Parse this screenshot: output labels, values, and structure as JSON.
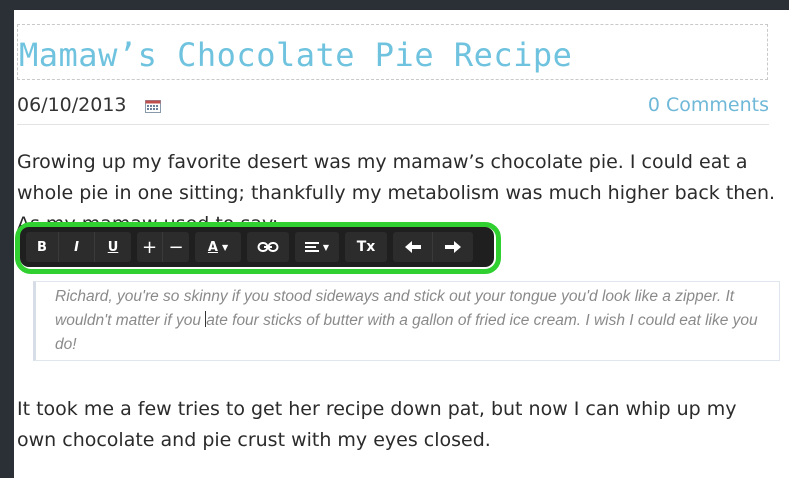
{
  "post": {
    "title": "Mamaw’s Chocolate Pie Recipe",
    "date": "06/10/2013",
    "comments_link": "0 Comments",
    "paragraph1": "Growing up my favorite desert was my mamaw’s chocolate pie. I could eat a whole pie in one sitting; thankfully my metabolism was much higher back then. As my mamaw used to say:",
    "quote_before_cursor": "Richard, you're so skinny if you stood sideways and stick out your tongue you'd look like a zipper. It wouldn't matter if you ",
    "quote_after_cursor": "ate four sticks of butter with a gallon of fried ice cream. I wish I could eat like you do!",
    "paragraph2": "It took me a few tries to get her recipe down pat, but now I can whip up my own chocolate and pie crust with my eyes closed."
  },
  "toolbar": {
    "bold": "B",
    "italic": "I",
    "underline": "U",
    "increase": "+",
    "decrease": "−",
    "font_color": "A",
    "clear_format": "Tx",
    "icons": [
      "calendar-icon",
      "link-icon",
      "align-icon",
      "undo-icon",
      "redo-icon"
    ]
  },
  "colors": {
    "title": "#6fc3df",
    "link": "#6fb8d8",
    "highlight": "#2fd02f",
    "toolbar_bg": "#1f1f1f"
  }
}
